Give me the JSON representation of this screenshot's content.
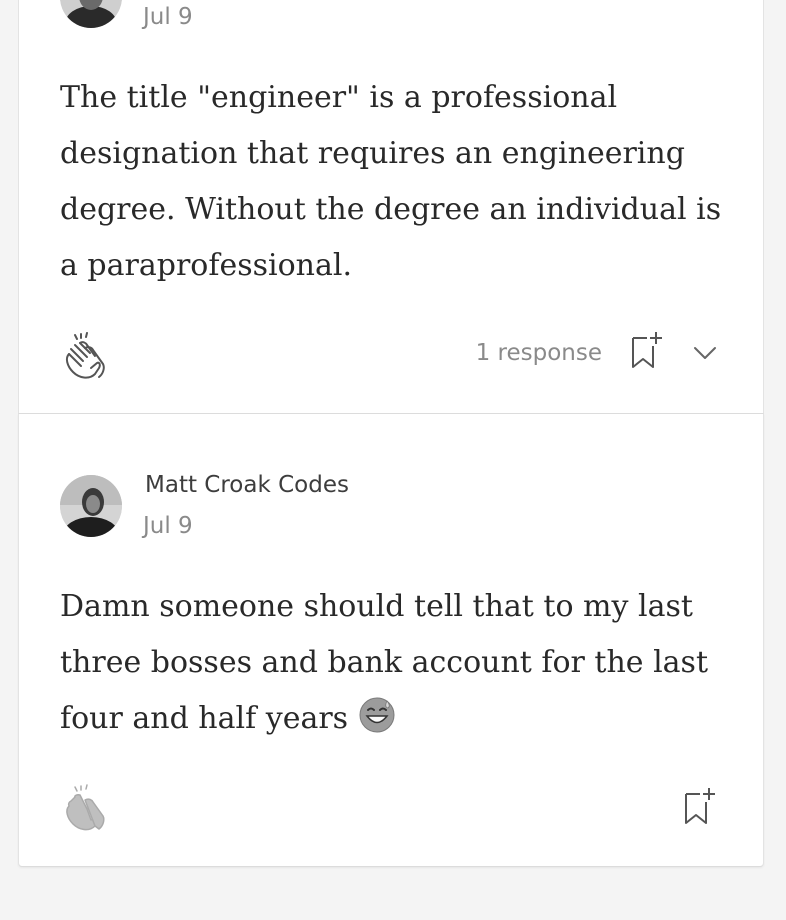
{
  "comments": [
    {
      "date": "Jul 9",
      "text": "The title \"engineer\" is a professional designation that requires an engineering degree. Without the degree an individual is a paraprofessional.",
      "responses_label": "1 response",
      "actions": {
        "clap_icon": "clap-hands-icon",
        "bookmark_icon": "bookmark-add-icon",
        "more_icon": "chevron-down-icon"
      }
    },
    {
      "author": "Matt Croak Codes",
      "date": "Jul 9",
      "text": "Damn someone should tell that to my last three bosses and bank account for the last four and half years",
      "emoji": "grinning-face-with-sweat-icon",
      "actions": {
        "clap_icon": "clap-hands-icon",
        "bookmark_icon": "bookmark-add-icon"
      }
    }
  ],
  "colors": {
    "background": "#f4f4f4",
    "card": "#ffffff",
    "text_primary": "#292929",
    "text_secondary": "#8a8a8a"
  }
}
